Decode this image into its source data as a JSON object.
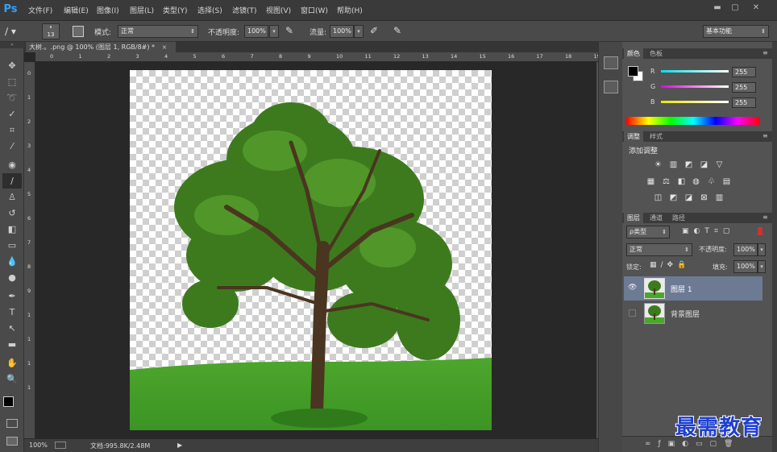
{
  "app": {
    "logo": "Ps"
  },
  "menu": [
    "文件(F)",
    "编辑(E)",
    "图像(I)",
    "图层(L)",
    "类型(Y)",
    "选择(S)",
    "滤镜(T)",
    "视图(V)",
    "窗口(W)",
    "帮助(H)"
  ],
  "window_buttons": [
    "minimize-icon",
    "restore-icon",
    "close-icon"
  ],
  "options": {
    "brush_size": "13",
    "mode_label": "模式:",
    "mode_value": "正常",
    "opacity_label": "不透明度:",
    "opacity_value": "100%",
    "flow_label": "流量:",
    "flow_value": "100%",
    "workspace": "基本功能"
  },
  "document": {
    "tab_title": "大树.。.png @ 100% (图层 1, RGB/8#) *",
    "ruler_h": [
      "0",
      "1",
      "2",
      "3",
      "4",
      "5",
      "6",
      "7",
      "8",
      "9",
      "10",
      "11",
      "12",
      "13",
      "14",
      "15",
      "16",
      "17",
      "18",
      "19"
    ],
    "ruler_v": [
      "0",
      "1",
      "2",
      "3",
      "4",
      "5",
      "6",
      "7",
      "8",
      "9",
      "1",
      "1",
      "1",
      "1"
    ],
    "status_zoom": "100%",
    "status_doc": "文档:995.8K/2.48M"
  },
  "color_panel": {
    "tabs": [
      "颜色",
      "色板"
    ],
    "channels": [
      {
        "label": "R",
        "value": "255",
        "color": "#00d8e0"
      },
      {
        "label": "G",
        "value": "255",
        "color": "#e000e0"
      },
      {
        "label": "B",
        "value": "255",
        "color": "#e0e000"
      }
    ]
  },
  "adjust_panel": {
    "tabs": [
      "调整",
      "样式"
    ],
    "title": "添加调整"
  },
  "layers_panel": {
    "tabs": [
      "图层",
      "通道",
      "路径"
    ],
    "filter_label": "ρ类型",
    "blend_mode": "正常",
    "opacity_label": "不透明度:",
    "opacity_value": "100%",
    "lock_label": "锁定:",
    "fill_label": "填充:",
    "fill_value": "100%",
    "layers": [
      {
        "name": "图层 1",
        "visible": true,
        "selected": true
      },
      {
        "name": "背景图层",
        "visible": false,
        "selected": false
      }
    ]
  },
  "tools": [
    "move-tool-icon",
    "marquee-tool-icon",
    "lasso-tool-icon",
    "quick-select-tool-icon",
    "crop-tool-icon",
    "eyedropper-tool-icon",
    "healing-tool-icon",
    "brush-tool-icon",
    "clone-stamp-tool-icon",
    "history-brush-tool-icon",
    "eraser-tool-icon",
    "gradient-tool-icon",
    "blur-tool-icon",
    "dodge-tool-icon",
    "pen-tool-icon",
    "type-tool-icon",
    "path-select-tool-icon",
    "shape-tool-icon",
    "hand-tool-icon",
    "zoom-tool-icon"
  ],
  "watermark": "最需教育"
}
